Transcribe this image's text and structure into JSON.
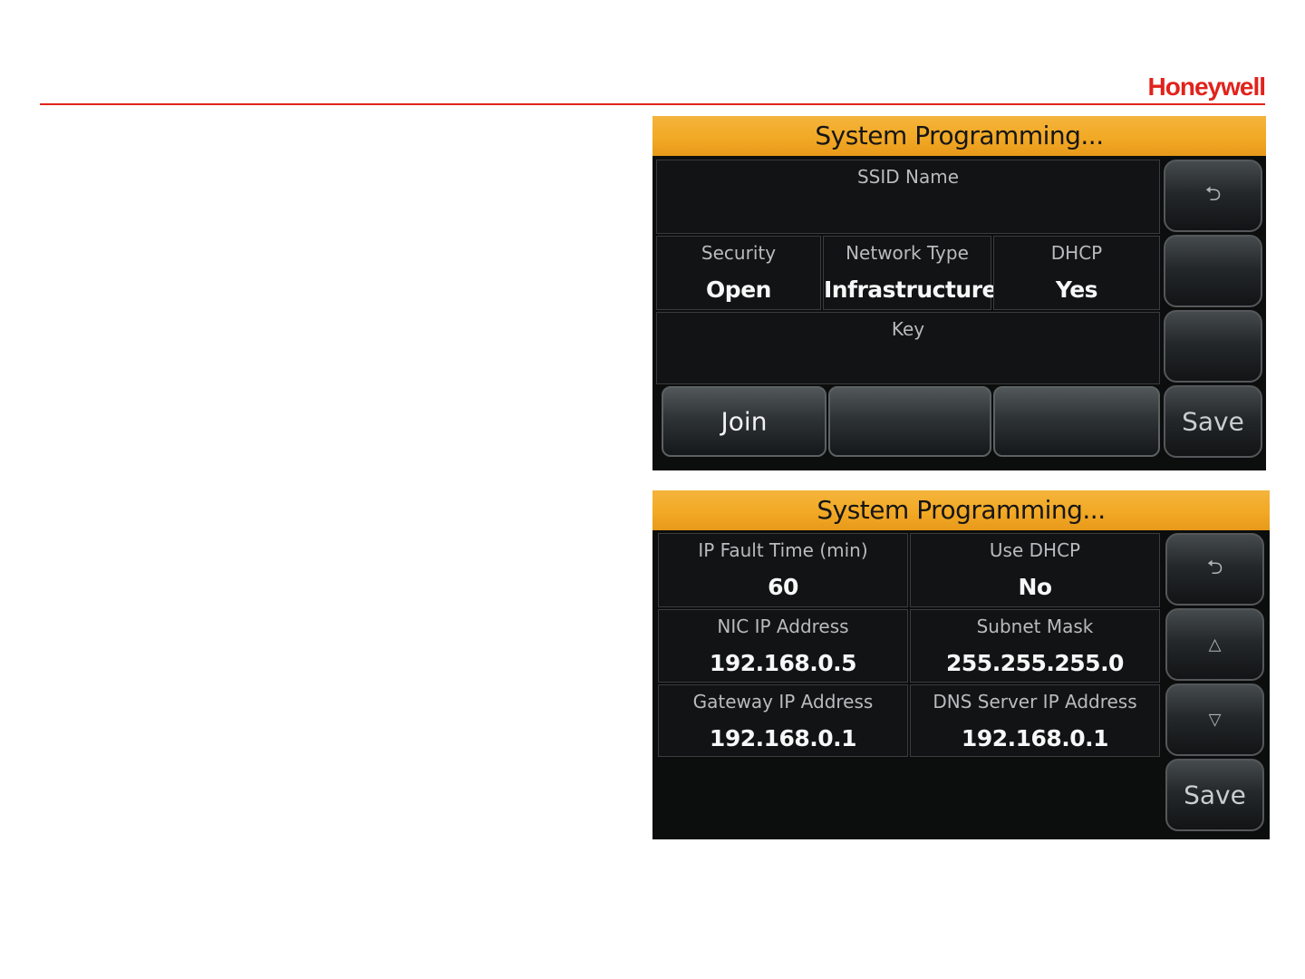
{
  "header": {
    "brand": "Honeywell",
    "brand_color": "#e0231c"
  },
  "screen_wifi": {
    "title": "System Programming...",
    "ssid": {
      "label": "SSID Name",
      "value": ""
    },
    "security": {
      "label": "Security",
      "value": "Open"
    },
    "network_type": {
      "label": "Network Type",
      "value": "Infrastructure"
    },
    "dhcp": {
      "label": "DHCP",
      "value": "Yes"
    },
    "key": {
      "label": "Key",
      "value": ""
    },
    "bottom_buttons": [
      "Join",
      "",
      ""
    ],
    "side_buttons": [
      {
        "icon": "back-arrow-icon",
        "label": ""
      },
      {
        "icon": "",
        "label": ""
      },
      {
        "icon": "",
        "label": ""
      },
      {
        "icon": "",
        "label": "Save"
      }
    ]
  },
  "screen_ip": {
    "title": "System Programming...",
    "fields": [
      {
        "label": "IP Fault Time (min)",
        "value": "60"
      },
      {
        "label": "Use DHCP",
        "value": "No"
      },
      {
        "label": "NIC IP Address",
        "value": "192.168.0.5"
      },
      {
        "label": "Subnet Mask",
        "value": "255.255.255.0"
      },
      {
        "label": "Gateway IP Address",
        "value": "192.168.0.1"
      },
      {
        "label": "DNS Server IP Address",
        "value": "192.168.0.1"
      }
    ],
    "side_buttons": [
      {
        "icon": "back-arrow-icon",
        "label": ""
      },
      {
        "icon": "up-arrow-icon",
        "label": ""
      },
      {
        "icon": "down-arrow-icon",
        "label": ""
      },
      {
        "icon": "",
        "label": "Save"
      }
    ]
  }
}
